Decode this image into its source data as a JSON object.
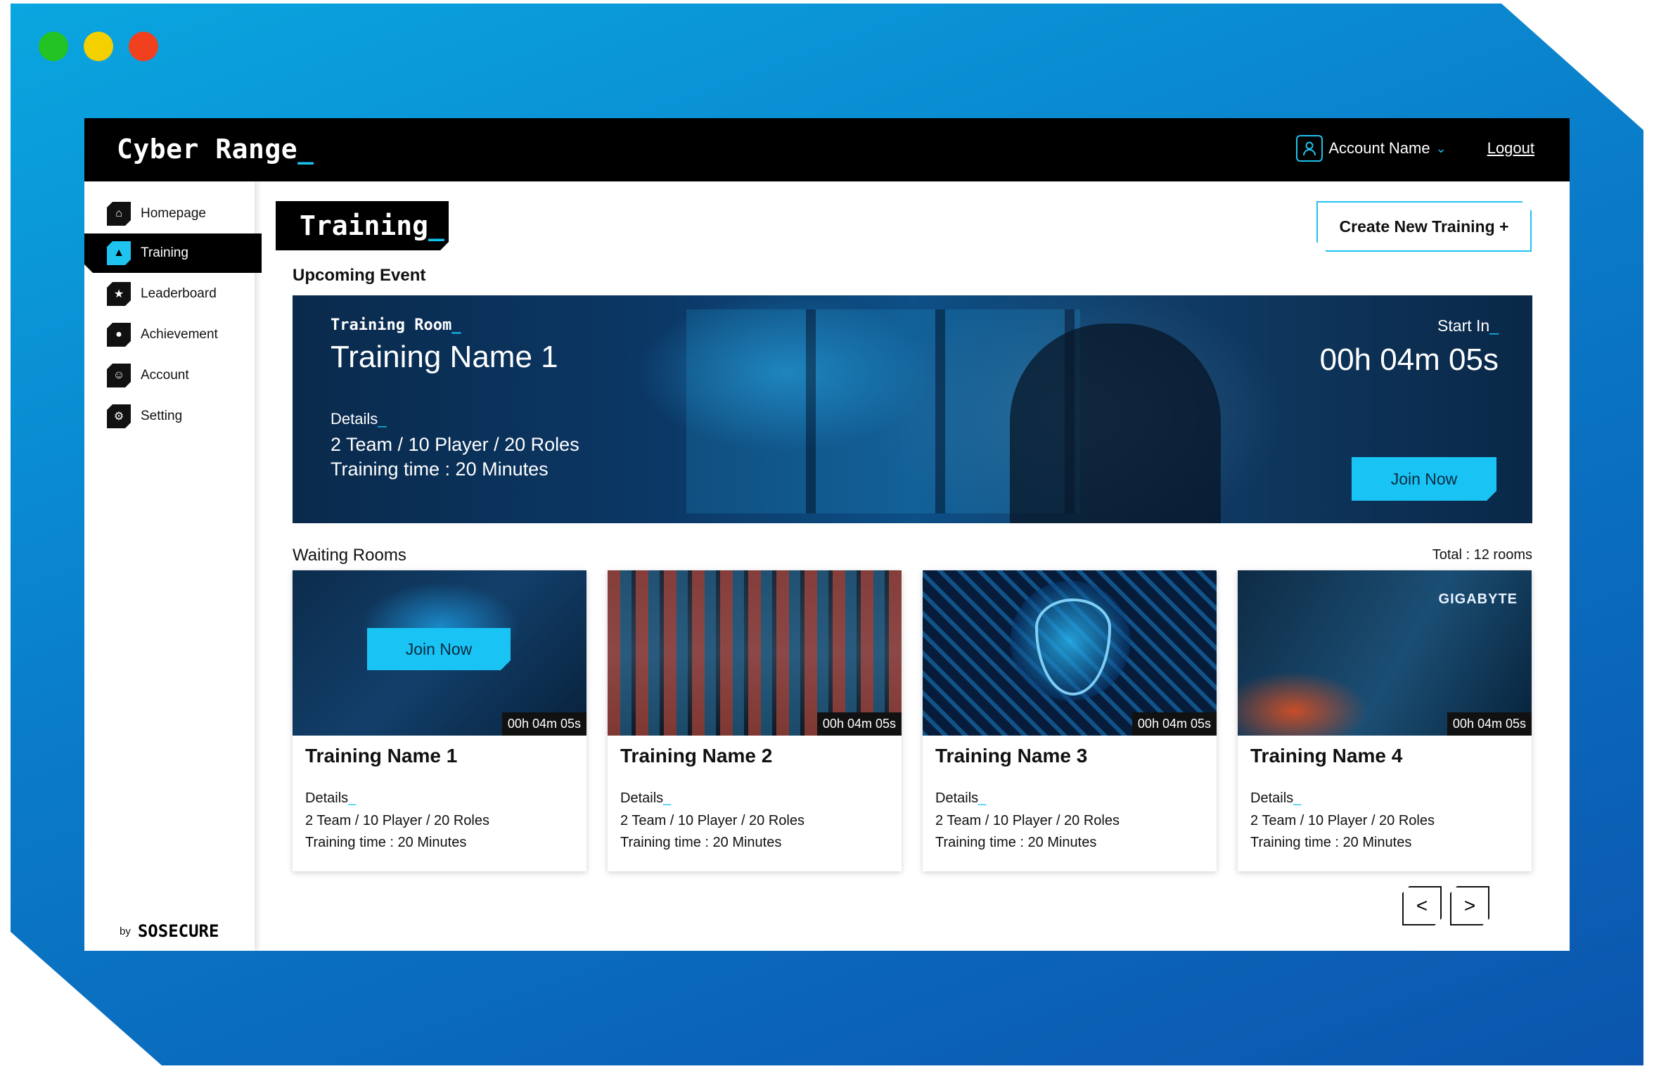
{
  "colors": {
    "accent": "#15c3f0",
    "bg_from": "#0aa6e0",
    "bg_to": "#0b55ad"
  },
  "brand": {
    "name": "Cyber Range",
    "cursor": "_"
  },
  "topbar": {
    "account_name": "Account Name",
    "logout": "Logout"
  },
  "sidebar": {
    "items": [
      {
        "label": "Homepage",
        "icon": "home-icon",
        "active": false
      },
      {
        "label": "Training",
        "icon": "graduation-cap-icon",
        "active": true
      },
      {
        "label": "Leaderboard",
        "icon": "trophy-icon",
        "active": false
      },
      {
        "label": "Achievement",
        "icon": "medal-icon",
        "active": false
      },
      {
        "label": "Account",
        "icon": "user-icon",
        "active": false
      },
      {
        "label": "Setting",
        "icon": "gear-icon",
        "active": false
      }
    ],
    "by": "by",
    "vendor": "SOSECURE"
  },
  "page": {
    "title": "Training",
    "cursor": "_",
    "create_button": "Create New Training +"
  },
  "upcoming": {
    "heading": "Upcoming Event",
    "kicker": "Training Room",
    "name": "Training Name 1",
    "details_label": "Details",
    "line1": "2 Team / 10 Player / 20 Roles",
    "line2": "Training time : 20 Minutes",
    "start_label": "Start In",
    "timer": "00h 04m 05s",
    "join": "Join Now"
  },
  "waiting": {
    "heading": "Waiting Rooms",
    "total": "Total : 12 rooms",
    "rooms": [
      {
        "name": "Training Name 1",
        "timer": "00h 04m 05s",
        "details_label": "Details",
        "line1": "2 Team / 10 Player / 20 Roles",
        "line2": "Training time : 20 Minutes",
        "join": "Join Now"
      },
      {
        "name": "Training Name 2",
        "timer": "00h 04m 05s",
        "details_label": "Details",
        "line1": "2 Team / 10 Player / 20 Roles",
        "line2": "Training time : 20 Minutes"
      },
      {
        "name": "Training Name 3",
        "timer": "00h 04m 05s",
        "details_label": "Details",
        "line1": "2 Team / 10 Player / 20 Roles",
        "line2": "Training time : 20 Minutes"
      },
      {
        "name": "Training Name 4",
        "timer": "00h 04m 05s",
        "details_label": "Details",
        "line1": "2 Team / 10 Player / 20 Roles",
        "line2": "Training time : 20 Minutes",
        "logo_text": "GIGABYTE"
      }
    ]
  },
  "pager": {
    "prev": "<",
    "next": ">"
  }
}
